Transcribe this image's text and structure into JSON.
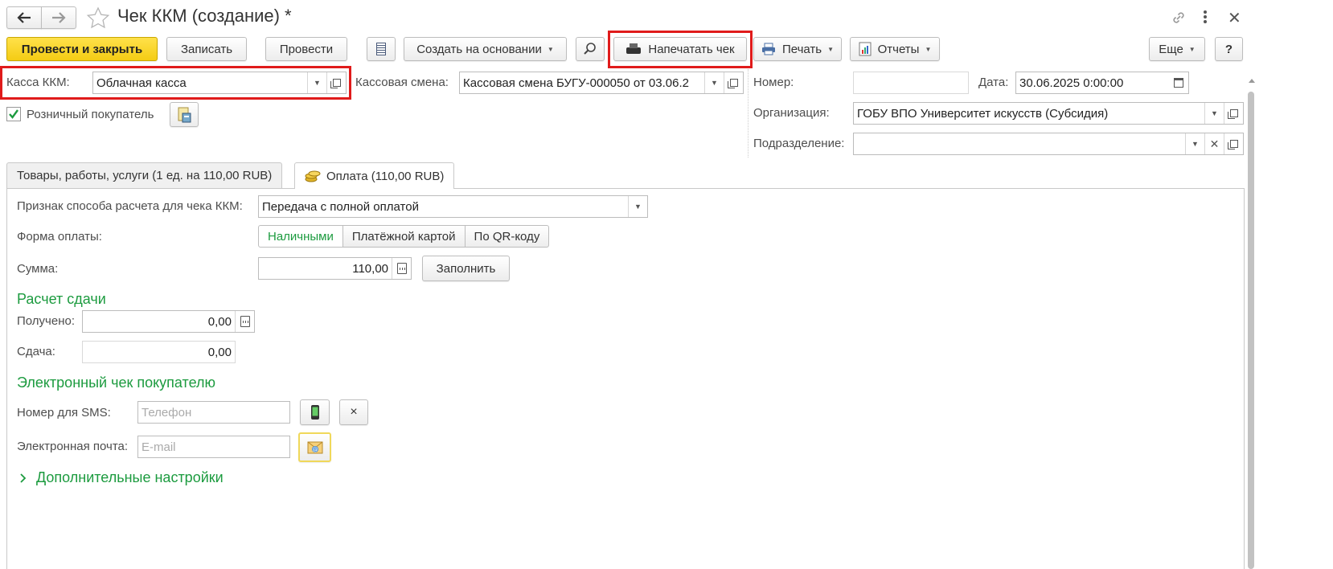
{
  "window": {
    "title": "Чек ККМ (создание) *",
    "nav_back_icon": "arrow-left-icon",
    "nav_forward_icon": "arrow-right-icon",
    "favorite_icon": "star-icon",
    "link_icon": "link-icon",
    "more_icon": "more-vert-icon",
    "close_icon": "close-icon"
  },
  "toolbar": {
    "post_and_close": "Провести и закрыть",
    "save": "Записать",
    "post": "Провести",
    "create_based_on": "Создать на основании",
    "print_receipt": "Напечатать чек",
    "print": "Печать",
    "reports": "Отчеты",
    "more": "Еще",
    "help": "?"
  },
  "header": {
    "kkm_label": "Касса ККМ:",
    "kkm_value": "Облачная касса",
    "shift_label": "Кассовая смена:",
    "shift_value": "Кассовая смена БУГУ-000050 от 03.06.2",
    "number_label": "Номер:",
    "number_value": "",
    "date_label": "Дата:",
    "date_value": "30.06.2025  0:00:00",
    "retail_buyer_label": "Розничный покупатель",
    "retail_buyer_checked": true,
    "org_label": "Организация:",
    "org_value": "ГОБУ ВПО Университет искусств (Субсидия)",
    "division_label": "Подразделение:",
    "division_value": ""
  },
  "tabs": [
    {
      "label": "Товары, работы, услуги (1 ед. на 110,00 RUB)",
      "active": false
    },
    {
      "label": "Оплата (110,00 RUB)",
      "active": true
    }
  ],
  "payment": {
    "method_label": "Признак способа расчета для чека ККМ:",
    "method_value": "Передача с полной оплатой",
    "form_label": "Форма оплаты:",
    "forms": [
      "Наличными",
      "Платёжной картой",
      "По QR-коду"
    ],
    "form_selected": "Наличными",
    "sum_label": "Сумма:",
    "sum_value": "110,00",
    "fill_button": "Заполнить",
    "change_title": "Расчет сдачи",
    "received_label": "Получено:",
    "received_value": "0,00",
    "change_label": "Сдача:",
    "change_value": "0,00",
    "ereceipt_title": "Электронный чек покупателю",
    "sms_label": "Номер для SMS:",
    "sms_placeholder": "Телефон",
    "email_label": "Электронная почта:",
    "email_placeholder": "E-mail",
    "clear_symbol": "×",
    "extra_settings": "Дополнительные настройки"
  },
  "colors": {
    "accent_green": "#1c9b3f",
    "primary_yellow": "#f4cc14",
    "highlight_red": "#e01b1b"
  }
}
